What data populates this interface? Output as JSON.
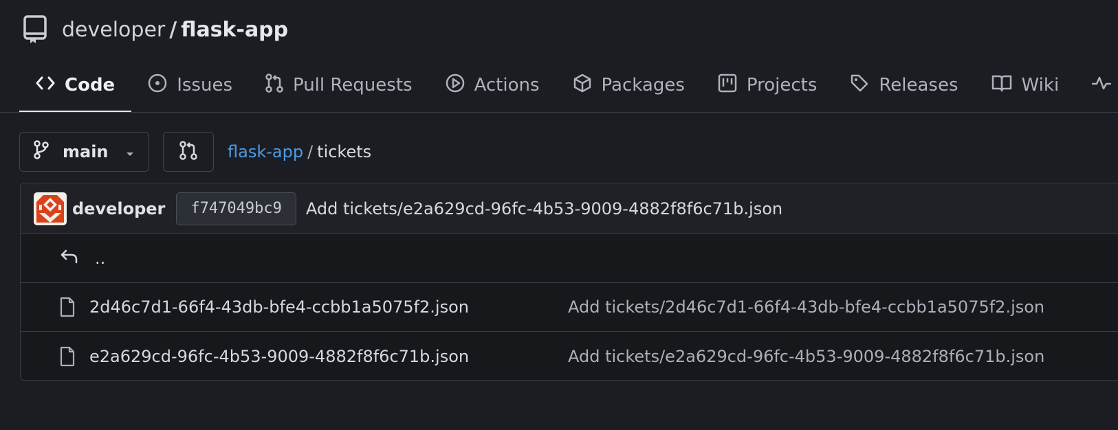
{
  "repo": {
    "owner": "developer",
    "separator": "/",
    "name": "flask-app"
  },
  "tabs": [
    {
      "label": "Code",
      "icon": "code-icon",
      "active": true
    },
    {
      "label": "Issues",
      "icon": "issue-icon",
      "active": false
    },
    {
      "label": "Pull Requests",
      "icon": "pull-request-icon",
      "active": false
    },
    {
      "label": "Actions",
      "icon": "play-icon",
      "active": false
    },
    {
      "label": "Packages",
      "icon": "package-icon",
      "active": false
    },
    {
      "label": "Projects",
      "icon": "project-icon",
      "active": false
    },
    {
      "label": "Releases",
      "icon": "tag-icon",
      "active": false
    },
    {
      "label": "Wiki",
      "icon": "book-icon",
      "active": false
    }
  ],
  "branch": {
    "name": "main"
  },
  "breadcrumb": {
    "repo_link": "flask-app",
    "separator": "/",
    "current": "tickets"
  },
  "latest_commit": {
    "author": "developer",
    "sha": "f747049bc9",
    "message": "Add tickets/e2a629cd-96fc-4b53-9009-4882f8f6c71b.json"
  },
  "parent_dir": {
    "label": ".."
  },
  "files": [
    {
      "name": "2d46c7d1-66f4-43db-bfe4-ccbb1a5075f2.json",
      "commit": "Add tickets/2d46c7d1-66f4-43db-bfe4-ccbb1a5075f2.json"
    },
    {
      "name": "e2a629cd-96fc-4b53-9009-4882f8f6c71b.json",
      "commit": "Add tickets/e2a629cd-96fc-4b53-9009-4882f8f6c71b.json"
    }
  ],
  "colors": {
    "background": "#1b1d22",
    "link": "#4c9be8",
    "avatar_primary": "#d9431b"
  }
}
